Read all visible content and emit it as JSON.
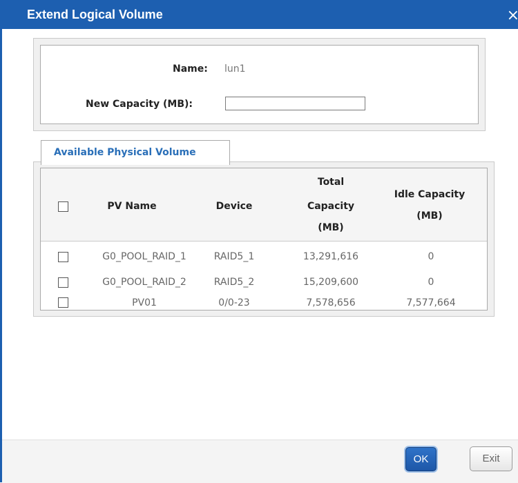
{
  "dialog": {
    "title": "Extend Logical Volume",
    "close_glyph": "×"
  },
  "form": {
    "name_label": "Name:",
    "name_value": "lun1",
    "capacity_label": "New Capacity (MB):",
    "capacity_value": ""
  },
  "tab": {
    "label": "Available Physical Volume"
  },
  "table": {
    "headers": {
      "pv_name": "PV Name",
      "device": "Device",
      "total_capacity_1": "Total",
      "total_capacity_2": "Capacity",
      "total_capacity_3": "(MB)",
      "idle_capacity_1": "Idle Capacity",
      "idle_capacity_2": "(MB)"
    },
    "rows": [
      {
        "pv_name": "G0_POOL_RAID_1",
        "device": "RAID5_1",
        "total": "13,291,616",
        "idle": "0"
      },
      {
        "pv_name": "G0_POOL_RAID_2",
        "device": "RAID5_2",
        "total": "15,209,600",
        "idle": "0"
      },
      {
        "pv_name": "PV01",
        "device": "0/0-23",
        "total": "7,578,656",
        "idle": "7,577,664"
      }
    ]
  },
  "buttons": {
    "ok": "OK",
    "exit": "Exit"
  },
  "colors": {
    "title_bar": "#1d5fb0",
    "tab_text": "#2a6fb8",
    "ok_button": "#1d57a8"
  }
}
